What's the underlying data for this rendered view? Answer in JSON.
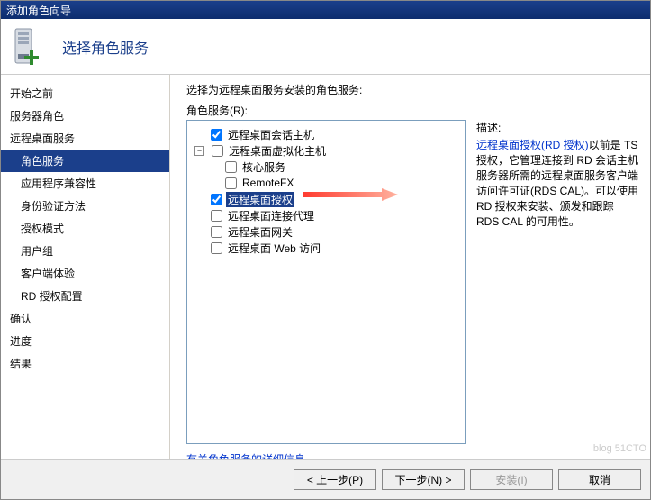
{
  "title": "添加角色向导",
  "header": {
    "heading": "选择角色服务"
  },
  "sidebar": {
    "items": [
      {
        "label": "开始之前",
        "level": 1
      },
      {
        "label": "服务器角色",
        "level": 1
      },
      {
        "label": "远程桌面服务",
        "level": 1
      },
      {
        "label": "角色服务",
        "level": 2,
        "selected": true
      },
      {
        "label": "应用程序兼容性",
        "level": 2
      },
      {
        "label": "身份验证方法",
        "level": 2
      },
      {
        "label": "授权模式",
        "level": 2
      },
      {
        "label": "用户组",
        "level": 2
      },
      {
        "label": "客户端体验",
        "level": 2
      },
      {
        "label": "RD 授权配置",
        "level": 2
      },
      {
        "label": "确认",
        "level": 1
      },
      {
        "label": "进度",
        "level": 1
      },
      {
        "label": "结果",
        "level": 1
      }
    ]
  },
  "main": {
    "prompt": "选择为远程桌面服务安装的角色服务:",
    "roles_label": "角色服务(R):",
    "tree": [
      {
        "label": "远程桌面会话主机",
        "checked": true,
        "indent": 18,
        "expander": ""
      },
      {
        "label": "远程桌面虚拟化主机",
        "checked": false,
        "indent": 4,
        "expander": "−"
      },
      {
        "label": "核心服务",
        "checked": false,
        "indent": 34,
        "expander": ""
      },
      {
        "label": "RemoteFX",
        "checked": false,
        "indent": 34,
        "expander": ""
      },
      {
        "label": "远程桌面授权",
        "checked": true,
        "indent": 18,
        "expander": "",
        "selected": true
      },
      {
        "label": "远程桌面连接代理",
        "checked": false,
        "indent": 18,
        "expander": ""
      },
      {
        "label": "远程桌面网关",
        "checked": false,
        "indent": 18,
        "expander": ""
      },
      {
        "label": "远程桌面 Web 访问",
        "checked": false,
        "indent": 18,
        "expander": ""
      }
    ],
    "desc_heading": "描述:",
    "desc_link": "远程桌面授权(RD 授权)",
    "desc_text": "以前是 TS 授权，它管理连接到 RD 会话主机服务器所需的远程桌面服务客户端访问许可证(RDS CAL)。可以使用 RD 授权来安装、颁发和跟踪 RDS CAL 的可用性。",
    "info_link": "有关角色服务的详细信息"
  },
  "footer": {
    "prev": "< 上一步(P)",
    "next": "下一步(N) >",
    "install": "安装(I)",
    "cancel": "取消"
  },
  "watermark": "blog 51CTO"
}
